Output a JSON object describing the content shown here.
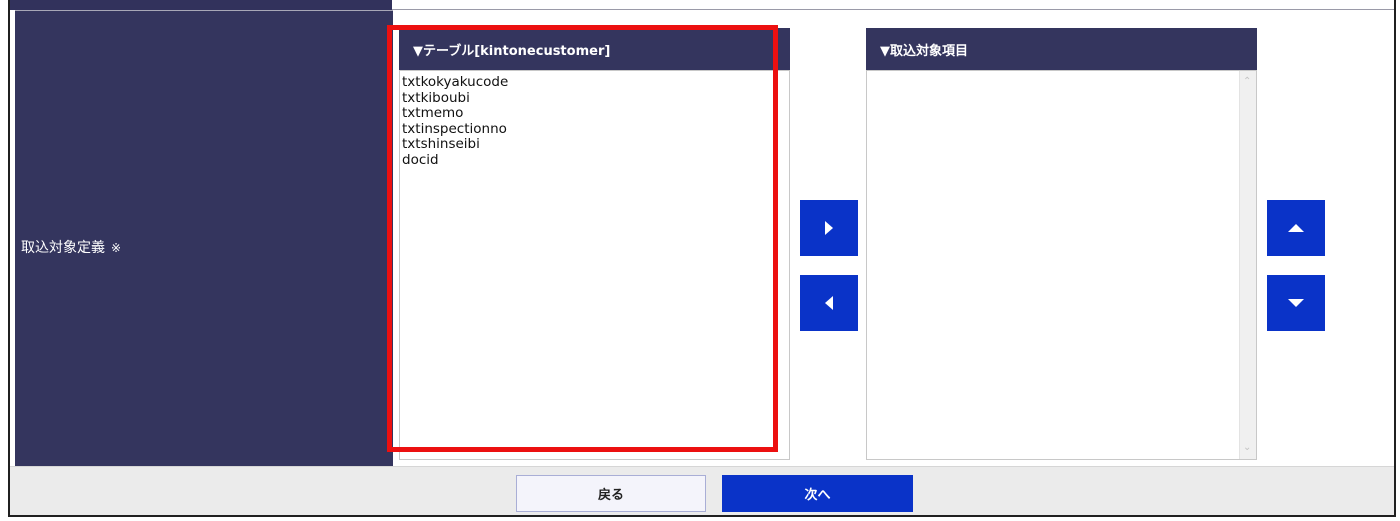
{
  "row": {
    "label": "取込対象定義",
    "required_mark": "※"
  },
  "source_panel": {
    "header": "▼テーブル[kintonecustomer]",
    "items": [
      "txtkokyakucode",
      "txtkiboubi",
      "txtmemo",
      "txtinspectionno",
      "txtshinseibi",
      "docid"
    ]
  },
  "target_panel": {
    "header": "▼取込対象項目",
    "items": []
  },
  "buttons": {
    "add_icon": "triangle-right-icon",
    "remove_icon": "triangle-left-icon",
    "up_icon": "triangle-up-icon",
    "down_icon": "triangle-down-icon"
  },
  "footer": {
    "back_label": "戻る",
    "next_label": "次へ"
  },
  "colors": {
    "header_bg": "#34355e",
    "primary_button": "#0a33c8",
    "highlight_border": "#ec1010"
  }
}
